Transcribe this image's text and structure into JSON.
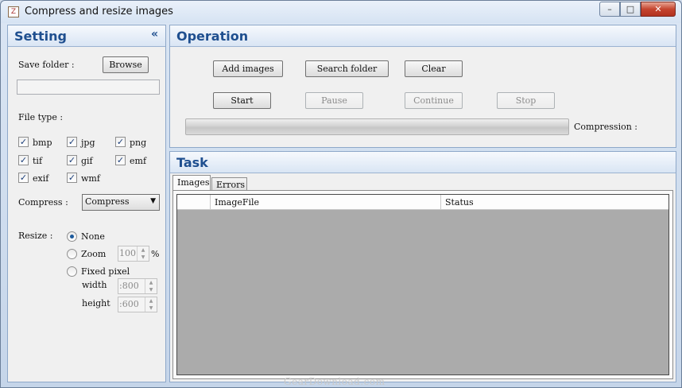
{
  "window": {
    "title": "Compress and resize images",
    "icon": "image-icon"
  },
  "controls": {
    "minimize_icon": "minimize-icon",
    "maximize_icon": "maximize-icon",
    "close_icon": "close-icon"
  },
  "setting": {
    "title": "Setting",
    "collapse_glyph": "«",
    "save_folder_label": "Save folder :",
    "browse_label": "Browse",
    "save_folder_value": "",
    "file_type_label": "File type :",
    "file_types": [
      {
        "label": "bmp",
        "checked": true
      },
      {
        "label": "jpg",
        "checked": true
      },
      {
        "label": "png",
        "checked": true
      },
      {
        "label": "tif",
        "checked": true
      },
      {
        "label": "gif",
        "checked": true
      },
      {
        "label": "emf",
        "checked": true
      },
      {
        "label": "exif",
        "checked": true
      },
      {
        "label": "wmf",
        "checked": true
      }
    ],
    "compress_label": "Compress :",
    "compress_value": "Compress",
    "resize_label": "Resize :",
    "resize_options": [
      {
        "label": "None",
        "selected": true
      },
      {
        "label": "Zoom",
        "selected": false
      },
      {
        "label": "Fixed pixel",
        "selected": false
      }
    ],
    "zoom_value": "100",
    "zoom_unit": "%",
    "width_label": "width",
    "width_value": ":800",
    "height_label": "height",
    "height_value": ":600"
  },
  "operation": {
    "title": "Operation",
    "add_images": "Add images",
    "search_folder": "Search folder",
    "clear": "Clear",
    "start": "Start",
    "pause": "Pause",
    "continue": "Continue",
    "stop": "Stop",
    "compression_label": "Compression :",
    "progress": 0
  },
  "task": {
    "title": "Task",
    "tabs": [
      "Images",
      "Errors"
    ],
    "active_tab": "Images",
    "columns": [
      "",
      "ImageFile",
      "Status"
    ],
    "rows": []
  },
  "watermark": "GearDownload.com",
  "check_glyph": "✓"
}
